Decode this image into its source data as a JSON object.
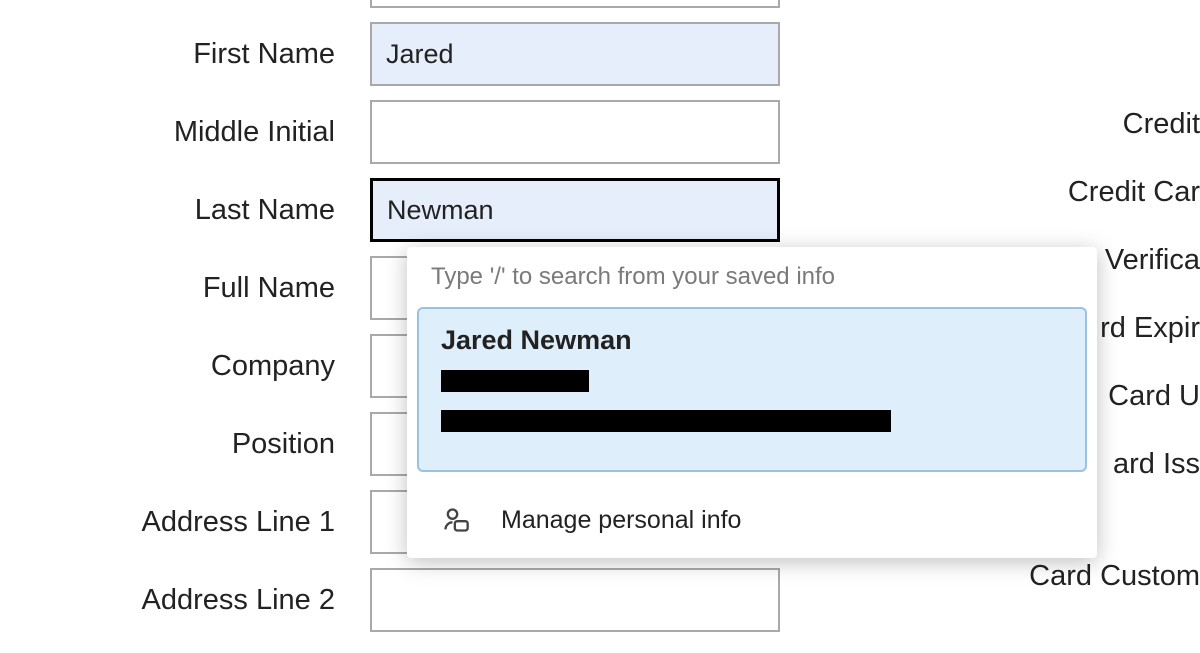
{
  "form": {
    "labels": {
      "first_name": "First Name",
      "middle_initial": "Middle Initial",
      "last_name": "Last Name",
      "full_name": "Full Name",
      "company": "Company",
      "position": "Position",
      "address_line_1": "Address Line 1",
      "address_line_2": "Address Line 2"
    },
    "values": {
      "first_name": "Jared",
      "middle_initial": "",
      "last_name": "Newman",
      "full_name": "",
      "company": "",
      "position": "",
      "address_line_1": "",
      "address_line_2": ""
    }
  },
  "right_labels": {
    "credit": "Credit",
    "credit_car": "Credit Car",
    "verifica": "Verifica",
    "rd_expir": "rd Expir",
    "card_u": "Card U",
    "card_iss": "ard Iss",
    "card_custom": "Card Custom"
  },
  "autofill": {
    "hint": "Type '/' to search from your saved info",
    "suggestion_name": "Jared Newman",
    "manage_label": "Manage personal info"
  }
}
